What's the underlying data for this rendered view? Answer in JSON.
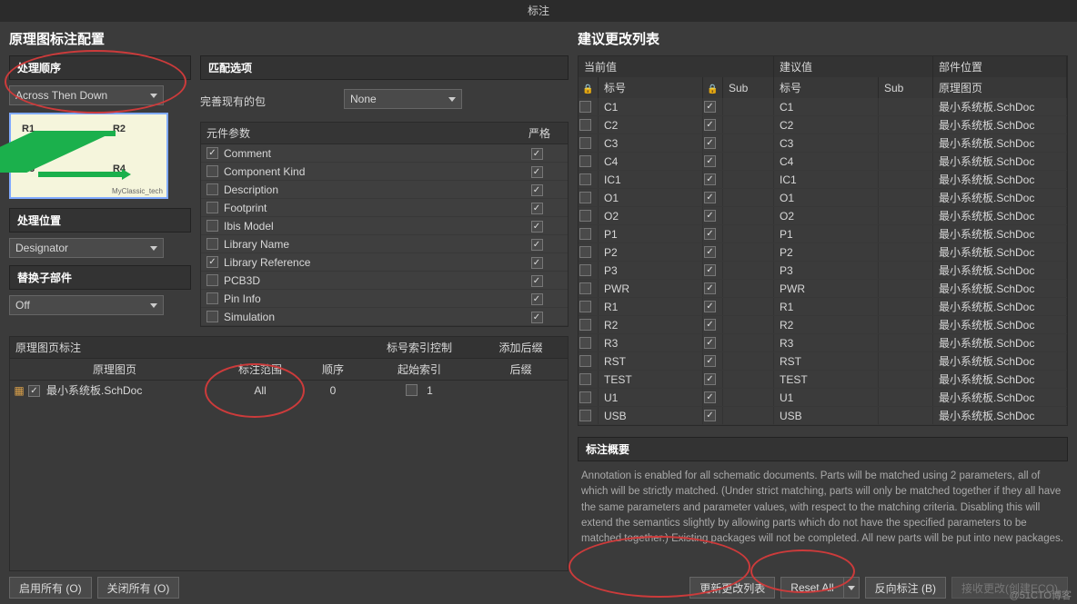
{
  "title": "标注",
  "left": {
    "heading": "原理图标注配置",
    "order_group": "处理顺序",
    "order_value": "Across Then Down",
    "location_group": "处理位置",
    "location_value": "Designator",
    "subparts_group": "替换子部件",
    "subparts_value": "Off",
    "matching_group": "匹配选项",
    "existing_label": "完善现有的包",
    "existing_value": "None",
    "param_header": "元件参数",
    "strict_header": "严格",
    "params": [
      {
        "name": "Comment",
        "on": true,
        "strict": true
      },
      {
        "name": "Component Kind",
        "on": false,
        "strict": true
      },
      {
        "name": "Description",
        "on": false,
        "strict": true
      },
      {
        "name": "Footprint",
        "on": false,
        "strict": true
      },
      {
        "name": "Ibis Model",
        "on": false,
        "strict": true
      },
      {
        "name": "Library Name",
        "on": false,
        "strict": true
      },
      {
        "name": "Library Reference",
        "on": true,
        "strict": true
      },
      {
        "name": "PCB3D",
        "on": false,
        "strict": true
      },
      {
        "name": "Pin Info",
        "on": false,
        "strict": true
      },
      {
        "name": "Simulation",
        "on": false,
        "strict": true
      }
    ],
    "sheet_section": "原理图页标注",
    "sheet_h_scope_group": "标号索引控制",
    "sheet_h_suffix_group": "添加后缀",
    "sheet_h_page": "原理图页",
    "sheet_h_scope": "标注范围",
    "sheet_h_order": "顺序",
    "sheet_h_start": "起始索引",
    "sheet_h_suffix": "后缀",
    "sheet_rows": [
      {
        "name": "最小系统板.SchDoc",
        "on": true,
        "scope": "All",
        "order": "0",
        "start_on": false,
        "start": "1",
        "suffix": ""
      }
    ]
  },
  "right": {
    "heading": "建议更改列表",
    "h_current": "当前值",
    "h_proposed": "建议值",
    "h_location": "部件位置",
    "h_des": "标号",
    "h_sub": "Sub",
    "h_sheet": "原理图页",
    "rows": [
      {
        "cur": "C1",
        "prop": "C1",
        "loc": "最小系统板.SchDoc"
      },
      {
        "cur": "C2",
        "prop": "C2",
        "loc": "最小系统板.SchDoc"
      },
      {
        "cur": "C3",
        "prop": "C3",
        "loc": "最小系统板.SchDoc"
      },
      {
        "cur": "C4",
        "prop": "C4",
        "loc": "最小系统板.SchDoc"
      },
      {
        "cur": "IC1",
        "prop": "IC1",
        "loc": "最小系统板.SchDoc"
      },
      {
        "cur": "O1",
        "prop": "O1",
        "loc": "最小系统板.SchDoc"
      },
      {
        "cur": "O2",
        "prop": "O2",
        "loc": "最小系统板.SchDoc"
      },
      {
        "cur": "P1",
        "prop": "P1",
        "loc": "最小系统板.SchDoc"
      },
      {
        "cur": "P2",
        "prop": "P2",
        "loc": "最小系统板.SchDoc"
      },
      {
        "cur": "P3",
        "prop": "P3",
        "loc": "最小系统板.SchDoc"
      },
      {
        "cur": "PWR",
        "prop": "PWR",
        "loc": "最小系统板.SchDoc"
      },
      {
        "cur": "R1",
        "prop": "R1",
        "loc": "最小系统板.SchDoc"
      },
      {
        "cur": "R2",
        "prop": "R2",
        "loc": "最小系统板.SchDoc"
      },
      {
        "cur": "R3",
        "prop": "R3",
        "loc": "最小系统板.SchDoc"
      },
      {
        "cur": "RST",
        "prop": "RST",
        "loc": "最小系统板.SchDoc"
      },
      {
        "cur": "TEST",
        "prop": "TEST",
        "loc": "最小系统板.SchDoc"
      },
      {
        "cur": "U1",
        "prop": "U1",
        "loc": "最小系统板.SchDoc"
      },
      {
        "cur": "USB",
        "prop": "USB",
        "loc": "最小系统板.SchDoc"
      }
    ],
    "summary_title": "标注概要",
    "summary_text": "Annotation is enabled for all schematic documents. Parts will be matched using 2 parameters, all of which will be strictly matched. (Under strict matching, parts will only be matched together if they all have the same parameters and parameter values, with respect to the matching criteria. Disabling this will extend the semantics slightly by allowing parts which do not have the specified parameters to be matched together.) Existing packages will not be completed. All new parts will be put into new packages."
  },
  "buttons": {
    "all_on": "启用所有 (O)",
    "all_off": "关闭所有 (O)",
    "update": "更新更改列表",
    "reset": "Reset All",
    "back": "反向标注 (B)",
    "accept": "接收更改(创建ECO)"
  },
  "watermark": "@51CTO博客",
  "preview": {
    "r1": "R1",
    "r2": "R2",
    "r3": "R3",
    "r4": "R4"
  }
}
